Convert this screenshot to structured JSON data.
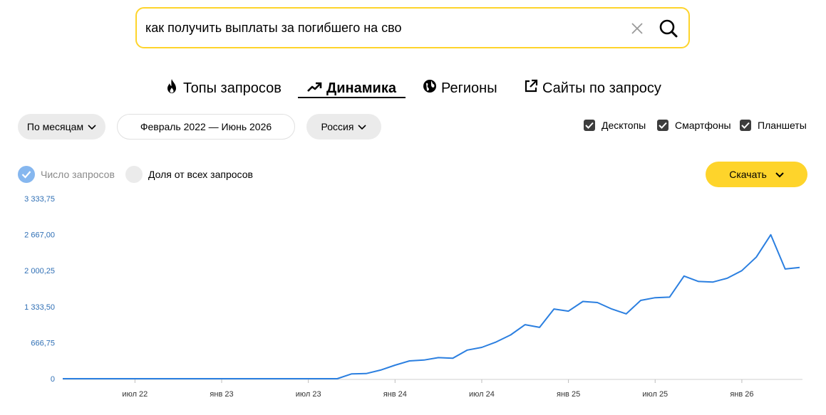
{
  "search": {
    "value": "как получить выплаты за погибшего на сво",
    "clear_icon": "close-icon",
    "submit_icon": "search-icon"
  },
  "tabs": [
    {
      "label": "Топы запросов",
      "icon": "fire-icon",
      "active": false
    },
    {
      "label": "Динамика",
      "icon": "trend-up-icon",
      "active": true
    },
    {
      "label": "Регионы",
      "icon": "globe-icon",
      "active": false
    },
    {
      "label": "Сайты по запросу",
      "icon": "external-link-icon",
      "active": false
    }
  ],
  "filters": {
    "period": "По месяцам",
    "date_range": "Февраль 2022 — Июнь 2026",
    "region": "Россия"
  },
  "devices": [
    {
      "label": "Десктопы",
      "checked": true
    },
    {
      "label": "Смартфоны",
      "checked": true
    },
    {
      "label": "Планшеты",
      "checked": true
    }
  ],
  "modes": {
    "count": {
      "label": "Число запросов",
      "selected": true
    },
    "share": {
      "label": "Доля от всех запросов",
      "selected": false
    }
  },
  "download_label": "Скачать",
  "colors": {
    "accent": "#fed42b",
    "line": "#2b7fe0",
    "tick_label": "#2f6fb5",
    "check": "#86b7ef"
  },
  "chart_data": {
    "type": "line",
    "y_ticks": [
      "3 333,75",
      "2 667,00",
      "2 000,25",
      "1 333,50",
      "666,75",
      "0"
    ],
    "y_tick_values": [
      3333.75,
      2667.0,
      2000.25,
      1333.5,
      666.75,
      0
    ],
    "ylim": [
      0,
      3333.75
    ],
    "x_ticks": [
      {
        "label": "июл 22",
        "index": 5
      },
      {
        "label": "янв 23",
        "index": 11
      },
      {
        "label": "июл 23",
        "index": 17
      },
      {
        "label": "янв 24",
        "index": 23
      },
      {
        "label": "июл 24",
        "index": 29
      },
      {
        "label": "янв 25",
        "index": 35
      },
      {
        "label": "июл 25",
        "index": 41
      },
      {
        "label": "янв 26",
        "index": 47
      }
    ],
    "grid": false,
    "series": [
      {
        "values": [
          0,
          0,
          0,
          0,
          0,
          0,
          0,
          0,
          0,
          0,
          0,
          0,
          0,
          0,
          0,
          0,
          0,
          0,
          0,
          0,
          90,
          95,
          160,
          250,
          330,
          345,
          390,
          380,
          530,
          580,
          680,
          810,
          1000,
          950,
          1290,
          1250,
          1430,
          1410,
          1290,
          1200,
          1450,
          1500,
          1510,
          1900,
          1800,
          1790,
          1860,
          2000,
          2250,
          2665,
          2030,
          2060
        ]
      }
    ]
  }
}
